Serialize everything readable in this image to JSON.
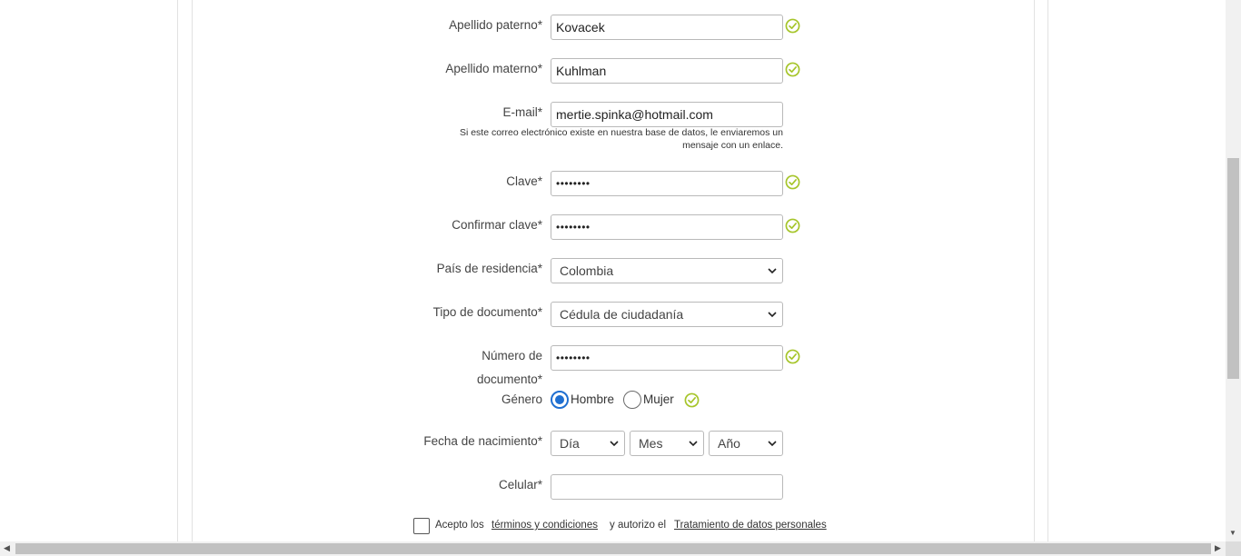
{
  "form": {
    "apellido_paterno": {
      "label": "Apellido paterno*",
      "value": "Kovacek"
    },
    "apellido_materno": {
      "label": "Apellido materno*",
      "value": "Kuhlman"
    },
    "email": {
      "label": "E-mail*",
      "value": "mertie.spinka@hotmail.com",
      "hint": "Si este correo electrónico existe en nuestra base de datos, le enviaremos un mensaje con un enlace."
    },
    "clave": {
      "label": "Clave*",
      "value": "••••••••"
    },
    "confirmar_clave": {
      "label": "Confirmar clave*",
      "value": "••••••••"
    },
    "pais": {
      "label": "País de residencia*",
      "value": "Colombia"
    },
    "tipo_documento": {
      "label": "Tipo de documento*",
      "value": "Cédula de ciudadanía"
    },
    "numero_documento": {
      "label": "Número de documento*",
      "value": "••••••••"
    },
    "genero": {
      "label": "Género",
      "options": [
        "Hombre",
        "Mujer"
      ],
      "selected": "Hombre"
    },
    "fecha_nacimiento": {
      "label": "Fecha de nacimiento*",
      "dia": "Día",
      "mes": "Mes",
      "anio": "Año"
    },
    "celular": {
      "label": "Celular*",
      "value": ""
    },
    "terms": {
      "prefix": "Acepto los",
      "terms_link": "términos y condiciones",
      "middle": "y autorizo el",
      "data_link": "Tratamiento de datos personales"
    }
  },
  "icons": {
    "valid": "check-circle-icon",
    "dropdown": "chevron-down-icon"
  },
  "colors": {
    "valid": "#a6c52a",
    "radio_selected": "#1f6fd1"
  }
}
